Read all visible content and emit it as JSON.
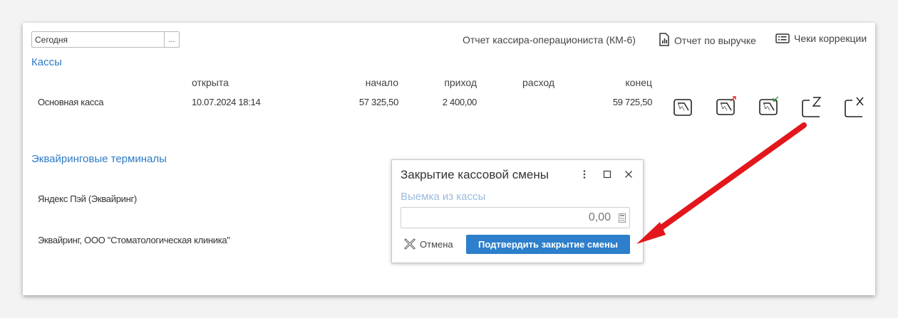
{
  "period": {
    "value": "Сегодня",
    "choose_label": "..."
  },
  "header_links": {
    "km6_report": "Отчет кассира-операциониста (КМ-6)",
    "revenue_report": "Отчет по выручке",
    "correction_receipts": "Чеки коррекции"
  },
  "cash_registers": {
    "title": "Кассы",
    "columns": {
      "opened": "открыта",
      "start": "начало",
      "income": "приход",
      "expense": "расход",
      "end": "конец"
    },
    "rows": [
      {
        "name": "Основная касса",
        "opened": "10.07.2024 18:14",
        "start": "57 325,50",
        "income": "2 400,00",
        "expense": "",
        "end": "59 725,50"
      }
    ],
    "action_icons": [
      "register-icon",
      "withdraw-icon",
      "deposit-icon",
      "z-report-icon",
      "x-report-icon"
    ]
  },
  "terminals": {
    "title": "Эквайринговые терминалы",
    "items": [
      {
        "name": "Яндекс Пэй (Эквайринг)"
      },
      {
        "name": "Эквайринг, ООО \"Стоматологическая клиника\""
      }
    ]
  },
  "dialog": {
    "title": "Закрытие кассовой смены",
    "withdrawal_label": "Выемка из кассы",
    "withdrawal_value": "0,00",
    "cancel_label": "Отмена",
    "confirm_label": "Подтвердить закрытие смены"
  },
  "colors": {
    "accent": "#2c7bc4",
    "button": "#2d7fcb",
    "arrow": "#e3171b"
  }
}
